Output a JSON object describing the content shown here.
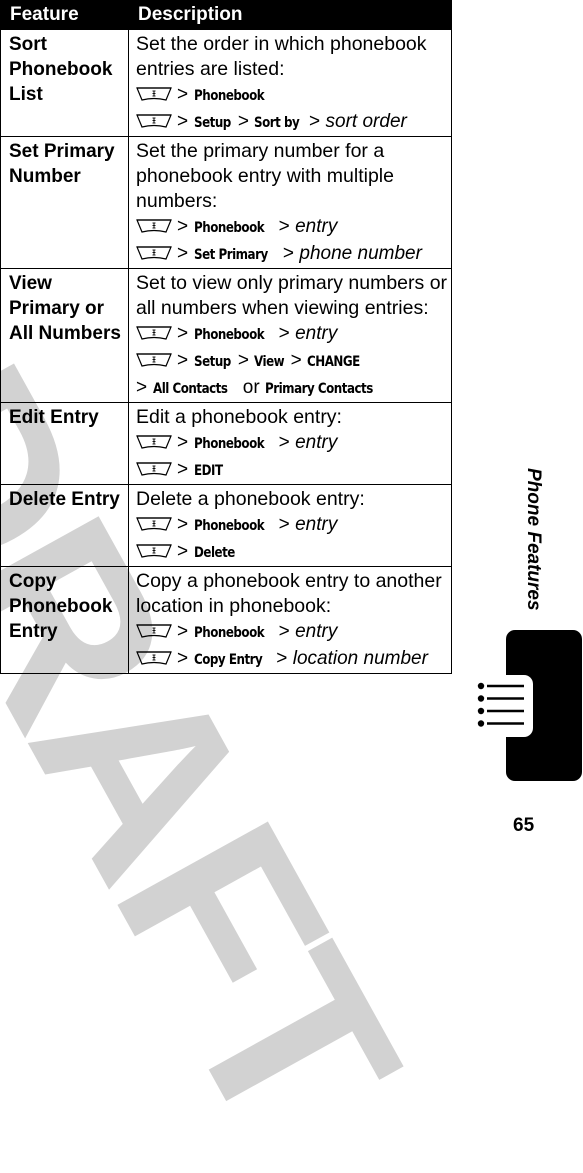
{
  "watermark": "DRAFT",
  "table": {
    "headers": {
      "feature": "Feature",
      "description": "Description"
    },
    "rows": [
      {
        "feature": [
          "Sort",
          "Phonebook",
          "List"
        ],
        "description": [
          "Set the order in which phonebook",
          "entries are listed:"
        ],
        "paths": [
          [
            {
              "t": "cmd",
              "v": "Phonebook"
            }
          ],
          [
            {
              "t": "cmd",
              "v": "Setup"
            },
            {
              "t": "sep",
              "v": ">"
            },
            {
              "t": "cmd",
              "v": "Sort by"
            },
            {
              "t": "sep",
              "v": ">"
            },
            {
              "t": "param",
              "v": "sort order"
            }
          ]
        ]
      },
      {
        "feature": [
          "Set Primary",
          "Number"
        ],
        "description": [
          "Set the primary number for a",
          "phonebook entry with multiple",
          "numbers:"
        ],
        "paths": [
          [
            {
              "t": "cmd",
              "v": "Phonebook"
            },
            {
              "t": "sep",
              "v": ">"
            },
            {
              "t": "param",
              "v": "entry"
            }
          ],
          [
            {
              "t": "cmd",
              "v": "Set Primary"
            },
            {
              "t": "sep",
              "v": ">"
            },
            {
              "t": "param",
              "v": "phone number"
            }
          ]
        ]
      },
      {
        "feature": [
          "View",
          "Primary or",
          "All Numbers"
        ],
        "description": [
          "Set to view only primary numbers or",
          "all numbers when viewing entries:"
        ],
        "paths": [
          [
            {
              "t": "cmd",
              "v": "Phonebook"
            },
            {
              "t": "sep",
              "v": ">"
            },
            {
              "t": "param",
              "v": "entry"
            }
          ],
          [
            {
              "t": "cmd",
              "v": "Setup"
            },
            {
              "t": "sep",
              "v": ">"
            },
            {
              "t": "cmd",
              "v": "View"
            },
            {
              "t": "sep",
              "v": ">"
            },
            {
              "t": "cmd",
              "v": "CHANGE"
            }
          ]
        ],
        "extra_line": [
          {
            "t": "sep",
            "v": ">"
          },
          {
            "t": "cmd",
            "v": "All Contacts"
          },
          {
            "t": "or",
            "v": "or"
          },
          {
            "t": "cmd",
            "v": "Primary Contacts"
          }
        ]
      },
      {
        "feature": [
          "Edit Entry"
        ],
        "description": [
          "Edit a phonebook entry:"
        ],
        "paths": [
          [
            {
              "t": "cmd",
              "v": "Phonebook"
            },
            {
              "t": "sep",
              "v": ">"
            },
            {
              "t": "param",
              "v": "entry"
            }
          ],
          [
            {
              "t": "cmd",
              "v": " EDIT"
            }
          ]
        ]
      },
      {
        "feature": [
          "Delete Entry"
        ],
        "description": [
          "Delete a phonebook entry:"
        ],
        "paths": [
          [
            {
              "t": "cmd",
              "v": "Phonebook"
            },
            {
              "t": "sep",
              "v": ">"
            },
            {
              "t": "param",
              "v": "entry"
            }
          ],
          [
            {
              "t": "cmd",
              "v": "Delete"
            }
          ]
        ]
      },
      {
        "feature": [
          "Copy",
          "Phonebook",
          "Entry"
        ],
        "description": [
          "Copy a phonebook entry to another",
          "location in phonebook:"
        ],
        "paths": [
          [
            {
              "t": "cmd",
              "v": "Phonebook"
            },
            {
              "t": "sep",
              "v": ">"
            },
            {
              "t": "param",
              "v": "entry"
            }
          ],
          [
            {
              "t": "cmd",
              "v": "Copy Entry"
            },
            {
              "t": "sep",
              "v": ">"
            },
            {
              "t": "param",
              "v": "location number"
            }
          ]
        ]
      }
    ]
  },
  "menu_key_icon": "menu-key-icon",
  "path_separator": ">",
  "side_title": "Phone Features",
  "section_icon": "list-icon",
  "page_number": "65"
}
